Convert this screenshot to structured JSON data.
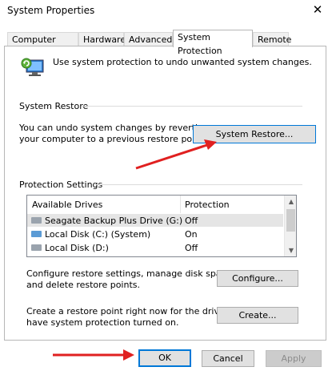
{
  "window": {
    "title": "System Properties",
    "close_symbol": "✕"
  },
  "tabs": [
    {
      "label": "Computer Name"
    },
    {
      "label": "Hardware"
    },
    {
      "label": "Advanced"
    },
    {
      "label": "System Protection"
    },
    {
      "label": "Remote"
    }
  ],
  "intro": {
    "text": "Use system protection to undo unwanted system changes."
  },
  "system_restore": {
    "group_label": "System Restore",
    "desc_line1": "You can undo system changes by reverting",
    "desc_line2": "your computer to a previous restore point.",
    "button": "System Restore..."
  },
  "protection": {
    "group_label": "Protection Settings",
    "columns": [
      "Available Drives",
      "Protection"
    ],
    "drives": [
      {
        "name": "Seagate Backup Plus Drive (G:)",
        "status": "Off"
      },
      {
        "name": "Local Disk (C:) (System)",
        "status": "On"
      },
      {
        "name": "Local Disk (D:)",
        "status": "Off"
      }
    ],
    "configure_line1": "Configure restore settings, manage disk space,",
    "configure_line2": "and delete restore points.",
    "configure_button": "Configure...",
    "create_line1": "Create a restore point right now for the drives that",
    "create_line2": "have system protection turned on.",
    "create_button": "Create..."
  },
  "footer": {
    "ok": "OK",
    "cancel": "Cancel",
    "apply": "Apply"
  },
  "colors": {
    "arrow": "#e02020",
    "focus": "#0078d7"
  }
}
